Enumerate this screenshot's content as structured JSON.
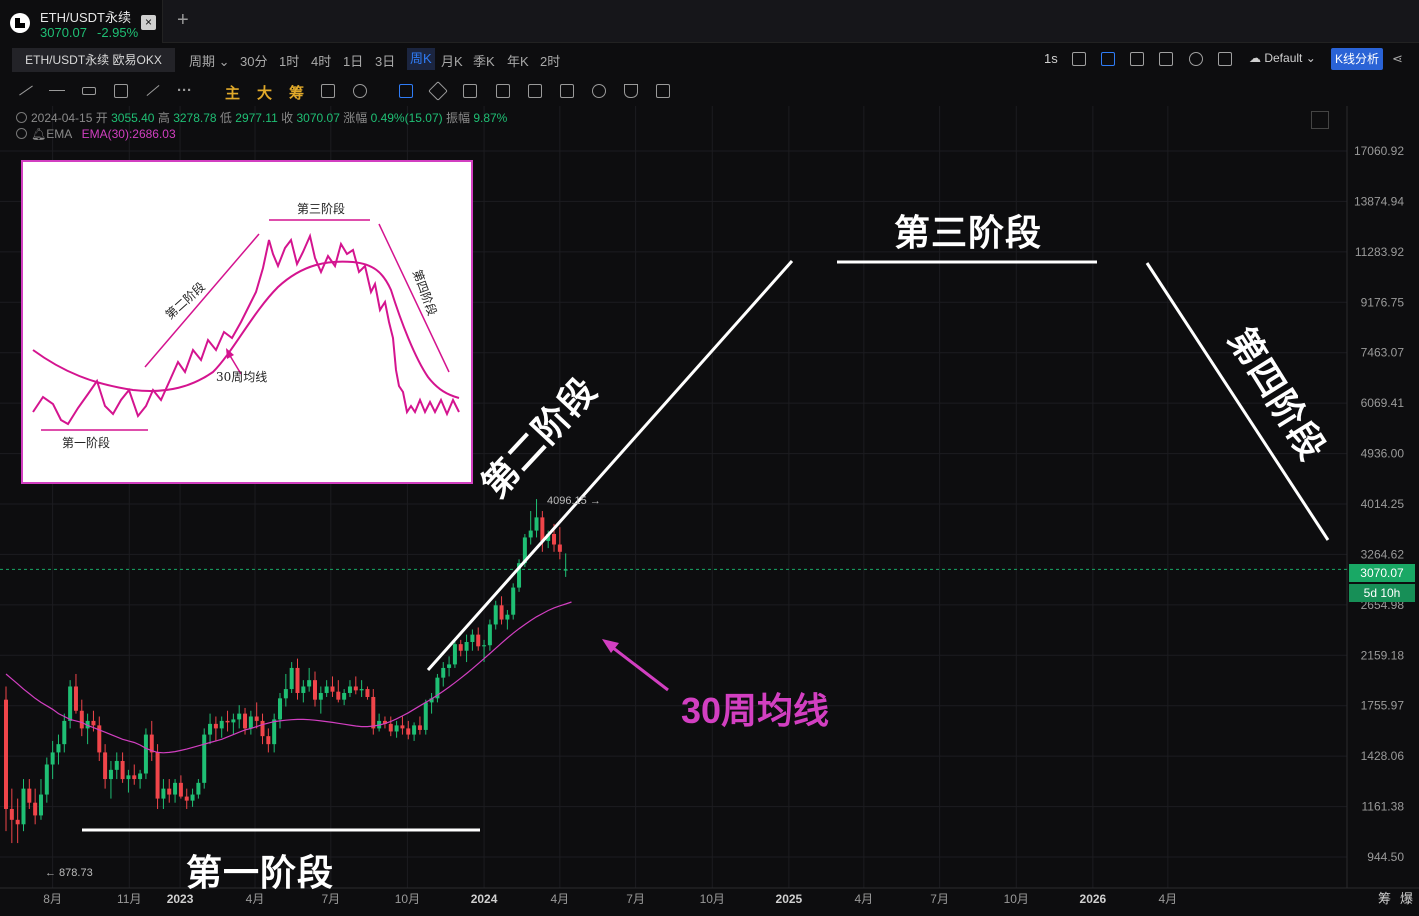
{
  "tab": {
    "title": "ETH/USDT永续",
    "price": "3070.07",
    "change": "-2.95%",
    "close": "×",
    "add": "+"
  },
  "toolbar": {
    "symbol": "ETH/USDT永续 欧易OKX",
    "period_label": "周期",
    "intervals": [
      "30分",
      "1时",
      "4时",
      "1日",
      "3日",
      "周K",
      "月K",
      "季K",
      "年K",
      "2时"
    ],
    "active_interval": "周K",
    "refresh": "1s",
    "theme": "Default",
    "analysis_button": "K线分析"
  },
  "toolbar2": {
    "indicators": [
      "主",
      "大",
      "筹"
    ]
  },
  "info": {
    "date": "2024-04-15",
    "open_label": "开",
    "open": "3055.40",
    "high_label": "高",
    "high": "3278.78",
    "low_label": "低",
    "low": "2977.11",
    "close_label": "收",
    "close": "3070.07",
    "chg_label": "涨幅",
    "chg": "0.49%(15.07)",
    "amp_label": "振幅",
    "amp": "9.87%",
    "ema_name": "EMA",
    "ema_value": "EMA(30):2686.03"
  },
  "annotations": {
    "stage1": "第一阶段",
    "stage2": "第二阶段",
    "stage3": "第三阶段",
    "stage4": "第四阶段",
    "ma30": "30周均线",
    "peak": "4096.15 →",
    "low": "← 878.73"
  },
  "inset": {
    "stage1": "第一阶段",
    "stage2": "第二阶段",
    "stage3": "第三阶段",
    "stage4": "第四阶段",
    "ma30": "30周均线"
  },
  "price_tags": {
    "current": "3070.07",
    "countdown": "5d 10h"
  },
  "chart_data": {
    "type": "candlestick",
    "title": "ETH/USDT永续",
    "ylabel": "",
    "xlabel": "",
    "yscale": "log",
    "ylim": [
      820,
      20000
    ],
    "y_ticks": [
      "17060.92",
      "13874.94",
      "11283.92",
      "9176.75",
      "7463.07",
      "6069.41",
      "4936.00",
      "4014.25",
      "3264.62",
      "2654.98",
      "2159.18",
      "1755.97",
      "1428.06",
      "1161.38",
      "944.50"
    ],
    "x_ticks": [
      "8月",
      "11月",
      "2023",
      "4月",
      "7月",
      "10月",
      "2024",
      "4月",
      "7月",
      "10月",
      "2025",
      "4月",
      "7月",
      "10月",
      "2026",
      "4月"
    ],
    "x_tick_dates": [
      "2022-08",
      "2022-11",
      "2023-01",
      "2023-04",
      "2023-07",
      "2023-10",
      "2024-01",
      "2024-04",
      "2024-07",
      "2024-10",
      "2025-01",
      "2025-04",
      "2025-07",
      "2025-10",
      "2026-01",
      "2026-04"
    ],
    "axis_corner": [
      "筹",
      "爆"
    ],
    "start_week": "2022-06-06",
    "current_price": 3070.07,
    "series": [
      {
        "name": "EMA(30)",
        "color": "#d23fc1",
        "values": [
          2000,
          1960,
          1920,
          1880,
          1845,
          1810,
          1780,
          1755,
          1730,
          1700,
          1680,
          1660,
          1650,
          1640,
          1620,
          1605,
          1590,
          1575,
          1560,
          1545,
          1530,
          1520,
          1510,
          1495,
          1475,
          1460,
          1450,
          1448,
          1450,
          1455,
          1462,
          1470,
          1480,
          1490,
          1500,
          1510,
          1520,
          1530,
          1545,
          1560,
          1575,
          1590,
          1600,
          1612,
          1625,
          1635,
          1645,
          1650,
          1655,
          1658,
          1660,
          1660,
          1658,
          1655,
          1650,
          1645,
          1640,
          1634,
          1628,
          1622,
          1616,
          1612,
          1612,
          1616,
          1622,
          1632,
          1646,
          1664,
          1684,
          1706,
          1730,
          1755,
          1780,
          1806,
          1834,
          1864,
          1896,
          1930,
          1966,
          2004,
          2044,
          2086,
          2130,
          2175,
          2222,
          2270,
          2318,
          2364,
          2408,
          2450,
          2490,
          2528,
          2562,
          2594,
          2622,
          2645,
          2664,
          2686.03
        ]
      }
    ],
    "candles": [
      [
        1800,
        1900,
        1050,
        1150
      ],
      [
        1150,
        1250,
        1000,
        1100
      ],
      [
        1100,
        1200,
        1000,
        1080
      ],
      [
        1080,
        1300,
        1050,
        1250
      ],
      [
        1250,
        1300,
        1150,
        1180
      ],
      [
        1180,
        1250,
        1080,
        1120
      ],
      [
        1120,
        1300,
        1100,
        1220
      ],
      [
        1220,
        1420,
        1180,
        1380
      ],
      [
        1380,
        1520,
        1300,
        1450
      ],
      [
        1450,
        1560,
        1380,
        1500
      ],
      [
        1500,
        1700,
        1450,
        1650
      ],
      [
        1650,
        1950,
        1600,
        1900
      ],
      [
        1900,
        2000,
        1700,
        1720
      ],
      [
        1720,
        1800,
        1550,
        1600
      ],
      [
        1600,
        1700,
        1500,
        1650
      ],
      [
        1650,
        1720,
        1580,
        1620
      ],
      [
        1620,
        1680,
        1400,
        1450
      ],
      [
        1450,
        1500,
        1250,
        1300
      ],
      [
        1300,
        1400,
        1200,
        1350
      ],
      [
        1350,
        1450,
        1300,
        1400
      ],
      [
        1400,
        1450,
        1280,
        1300
      ],
      [
        1300,
        1350,
        1230,
        1320
      ],
      [
        1320,
        1380,
        1270,
        1300
      ],
      [
        1300,
        1350,
        1250,
        1330
      ],
      [
        1330,
        1600,
        1300,
        1560
      ],
      [
        1560,
        1650,
        1400,
        1450
      ],
      [
        1450,
        1500,
        1150,
        1200
      ],
      [
        1200,
        1300,
        1150,
        1250
      ],
      [
        1250,
        1300,
        1180,
        1220
      ],
      [
        1220,
        1300,
        1180,
        1280
      ],
      [
        1280,
        1320,
        1200,
        1210
      ],
      [
        1210,
        1250,
        1150,
        1190
      ],
      [
        1190,
        1250,
        1160,
        1220
      ],
      [
        1220,
        1300,
        1200,
        1280
      ],
      [
        1280,
        1600,
        1250,
        1560
      ],
      [
        1560,
        1700,
        1500,
        1630
      ],
      [
        1630,
        1680,
        1520,
        1600
      ],
      [
        1600,
        1680,
        1540,
        1650
      ],
      [
        1650,
        1720,
        1580,
        1640
      ],
      [
        1640,
        1700,
        1560,
        1660
      ],
      [
        1660,
        1760,
        1600,
        1700
      ],
      [
        1700,
        1740,
        1560,
        1600
      ],
      [
        1600,
        1720,
        1560,
        1680
      ],
      [
        1680,
        1780,
        1600,
        1650
      ],
      [
        1650,
        1700,
        1500,
        1550
      ],
      [
        1550,
        1600,
        1450,
        1500
      ],
      [
        1500,
        1700,
        1450,
        1660
      ],
      [
        1660,
        1850,
        1600,
        1810
      ],
      [
        1810,
        2000,
        1750,
        1880
      ],
      [
        1880,
        2100,
        1850,
        2050
      ],
      [
        2050,
        2130,
        1800,
        1850
      ],
      [
        1850,
        1950,
        1780,
        1900
      ],
      [
        1900,
        2050,
        1860,
        1950
      ],
      [
        1950,
        2020,
        1750,
        1800
      ],
      [
        1800,
        1900,
        1700,
        1850
      ],
      [
        1850,
        1950,
        1820,
        1900
      ],
      [
        1900,
        1980,
        1820,
        1860
      ],
      [
        1860,
        1950,
        1780,
        1800
      ],
      [
        1800,
        1880,
        1760,
        1850
      ],
      [
        1850,
        1950,
        1820,
        1900
      ],
      [
        1900,
        1980,
        1840,
        1870
      ],
      [
        1870,
        1950,
        1820,
        1880
      ],
      [
        1880,
        1900,
        1800,
        1820
      ],
      [
        1820,
        1880,
        1560,
        1600
      ],
      [
        1600,
        1700,
        1580,
        1650
      ],
      [
        1650,
        1680,
        1600,
        1630
      ],
      [
        1630,
        1680,
        1550,
        1580
      ],
      [
        1580,
        1650,
        1540,
        1620
      ],
      [
        1620,
        1680,
        1560,
        1600
      ],
      [
        1600,
        1650,
        1530,
        1560
      ],
      [
        1560,
        1640,
        1520,
        1620
      ],
      [
        1620,
        1680,
        1560,
        1590
      ],
      [
        1590,
        1800,
        1560,
        1780
      ],
      [
        1780,
        1850,
        1700,
        1810
      ],
      [
        1810,
        2000,
        1780,
        1970
      ],
      [
        1970,
        2100,
        1900,
        2050
      ],
      [
        2050,
        2150,
        1980,
        2080
      ],
      [
        2080,
        2300,
        2050,
        2260
      ],
      [
        2260,
        2300,
        2150,
        2200
      ],
      [
        2200,
        2350,
        2100,
        2280
      ],
      [
        2280,
        2400,
        2200,
        2350
      ],
      [
        2350,
        2420,
        2200,
        2240
      ],
      [
        2240,
        2300,
        2100,
        2250
      ],
      [
        2250,
        2500,
        2200,
        2450
      ],
      [
        2450,
        2700,
        2400,
        2650
      ],
      [
        2650,
        2750,
        2450,
        2500
      ],
      [
        2500,
        2600,
        2400,
        2550
      ],
      [
        2550,
        2900,
        2500,
        2850
      ],
      [
        2850,
        3200,
        2800,
        3150
      ],
      [
        3150,
        3550,
        3100,
        3500
      ],
      [
        3500,
        3900,
        3400,
        3600
      ],
      [
        3600,
        4096,
        3500,
        3800
      ],
      [
        3800,
        3900,
        3300,
        3450
      ],
      [
        3450,
        3600,
        3350,
        3550
      ],
      [
        3550,
        3700,
        3300,
        3400
      ],
      [
        3400,
        3650,
        3200,
        3300
      ],
      [
        3055.4,
        3278.78,
        2977.11,
        3070.07
      ]
    ]
  }
}
